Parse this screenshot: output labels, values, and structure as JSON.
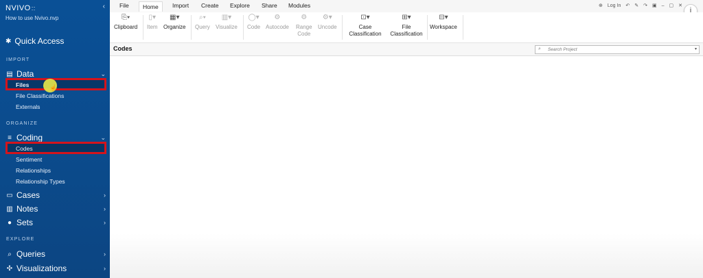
{
  "app": {
    "logo": "NVIVO",
    "logo_mark": "::",
    "project_name": "How to use Nvivo.nvp",
    "collapse_icon": "chevron-left-icon"
  },
  "sidebar": {
    "quick_access": "Quick Access",
    "sections": {
      "import": "IMPORT",
      "organize": "ORGANIZE",
      "explore": "EXPLORE"
    },
    "data": {
      "label": "Data",
      "items": [
        "Files",
        "File Classifications",
        "Externals"
      ]
    },
    "coding": {
      "label": "Coding",
      "items": [
        "Codes",
        "Sentiment",
        "Relationships",
        "Relationship Types"
      ]
    },
    "cases": "Cases",
    "notes": "Notes",
    "sets": "Sets",
    "queries": "Queries",
    "visualizations": "Visualizations"
  },
  "menu": {
    "tabs": [
      "File",
      "Home",
      "Import",
      "Create",
      "Explore",
      "Share",
      "Modules"
    ],
    "active_tab": "Home",
    "login": "Log In"
  },
  "ribbon": {
    "clipboard": "Clipboard",
    "item": "Item",
    "organize": "Organize",
    "query": "Query",
    "visualize": "Visualize",
    "code": "Code",
    "autocode": "Autocode",
    "range_code_1": "Range",
    "range_code_2": "Code",
    "uncode": "Uncode",
    "case_classification_1": "Case",
    "case_classification_2": "Classification",
    "file_classification_1": "File",
    "file_classification_2": "Classification",
    "workspace": "Workspace"
  },
  "content": {
    "title": "Codes",
    "search_placeholder": "Search Project"
  },
  "colors": {
    "sidebar_bg": "#0a5096",
    "highlight_border": "#d4141c",
    "cursor_highlight": "#e4e64a"
  }
}
